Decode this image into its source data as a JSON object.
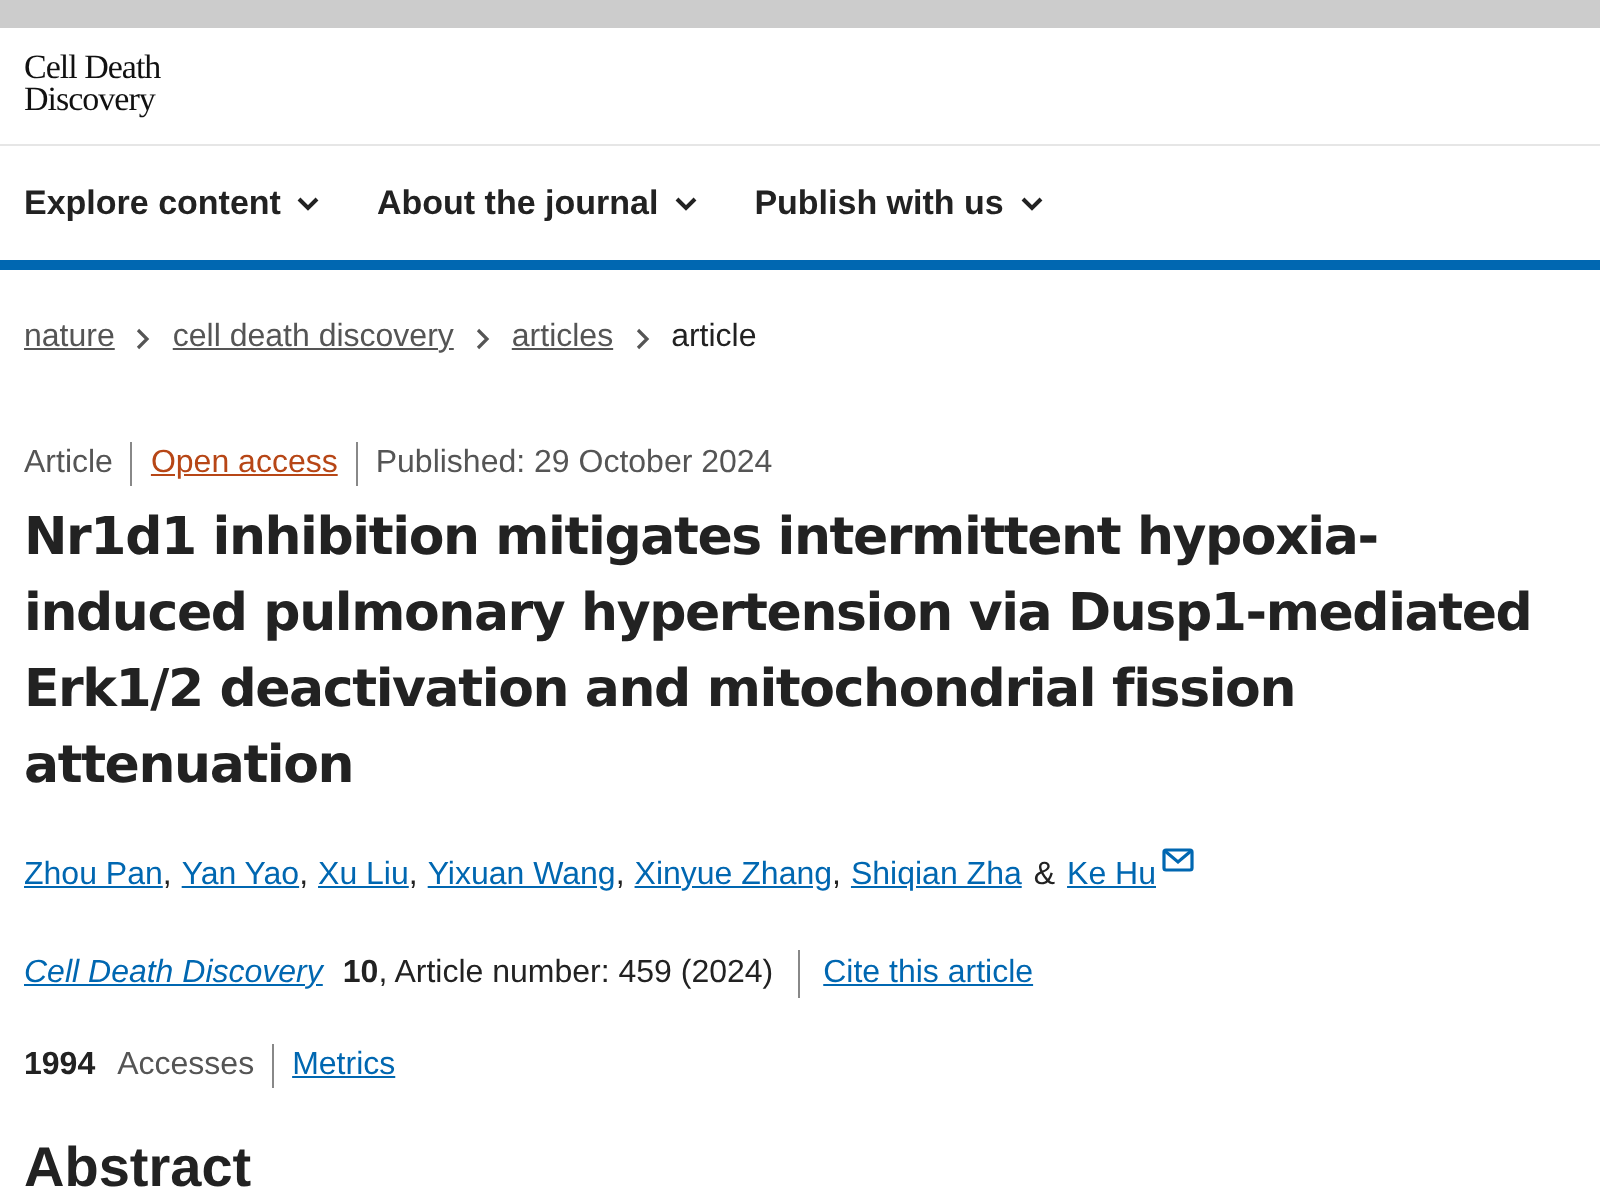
{
  "logo": {
    "line_1": "Cell Death",
    "line_2": "Discovery"
  },
  "nav": [
    {
      "label": "Explore content"
    },
    {
      "label": "About the journal"
    },
    {
      "label": "Publish with us"
    }
  ],
  "breadcrumbs": [
    {
      "label": "nature",
      "link": true
    },
    {
      "label": "cell death discovery",
      "link": true
    },
    {
      "label": "articles",
      "link": true
    },
    {
      "label": "article",
      "link": false
    }
  ],
  "meta": {
    "type": "Article",
    "access": "Open access",
    "published": "Published: 29 October 2024"
  },
  "title": "Nr1d1 inhibition mitigates intermittent hypoxia-induced pulmonary hypertension via Dusp1-mediated Erk1/2 deactivation and mitochondrial fission attenuation",
  "authors": [
    {
      "name": "Zhou Pan",
      "sep": ","
    },
    {
      "name": "Yan Yao",
      "sep": ","
    },
    {
      "name": "Xu Liu",
      "sep": ","
    },
    {
      "name": "Yixuan Wang",
      "sep": ","
    },
    {
      "name": "Xinyue Zhang",
      "sep": ","
    },
    {
      "name": "Shiqian Zha",
      "sep": "&"
    },
    {
      "name": "Ke Hu",
      "corresponding": true
    }
  ],
  "citation": {
    "journal": "Cell Death Discovery",
    "volume": "10",
    "details": ", Article number: 459 (2024)",
    "cite": "Cite this article"
  },
  "stats": {
    "count": "1994",
    "label": "Accesses",
    "metrics": "Metrics"
  },
  "section_heading": "Abstract"
}
